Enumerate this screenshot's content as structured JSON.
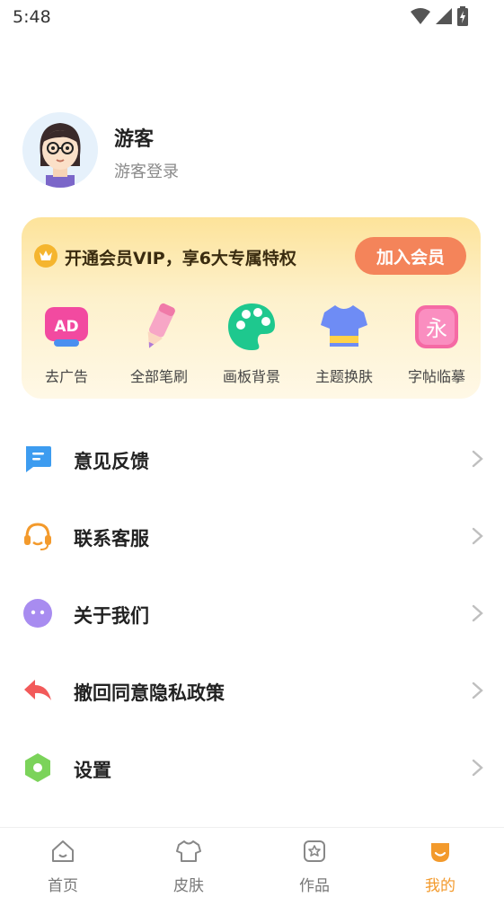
{
  "status_bar": {
    "time": "5:48"
  },
  "profile": {
    "name": "游客",
    "subtitle": "游客登录"
  },
  "vip": {
    "promo_text": "开通会员VIP，享6大专属特权",
    "join_button": "加入会员",
    "perks": [
      {
        "label": "去广告",
        "icon": "ad-icon"
      },
      {
        "label": "全部笔刷",
        "icon": "brush-icon"
      },
      {
        "label": "画板背景",
        "icon": "palette-icon"
      },
      {
        "label": "主题换肤",
        "icon": "shirt-icon"
      },
      {
        "label": "字帖临摹",
        "icon": "calligraphy-icon"
      }
    ],
    "ad_badge": "AD",
    "calligraphy_char": "永"
  },
  "menu": [
    {
      "label": "意见反馈",
      "icon": "feedback-icon"
    },
    {
      "label": "联系客服",
      "icon": "headset-icon"
    },
    {
      "label": "关于我们",
      "icon": "smile-icon"
    },
    {
      "label": "撤回同意隐私政策",
      "icon": "undo-icon"
    },
    {
      "label": "设置",
      "icon": "gear-icon"
    }
  ],
  "bottom_nav": [
    {
      "label": "首页",
      "icon": "home-icon"
    },
    {
      "label": "皮肤",
      "icon": "shirt-icon"
    },
    {
      "label": "作品",
      "icon": "gallery-icon"
    },
    {
      "label": "我的",
      "icon": "profile-icon"
    }
  ],
  "colors": {
    "accent": "#f39a2c",
    "vip_button": "#f4845a"
  }
}
